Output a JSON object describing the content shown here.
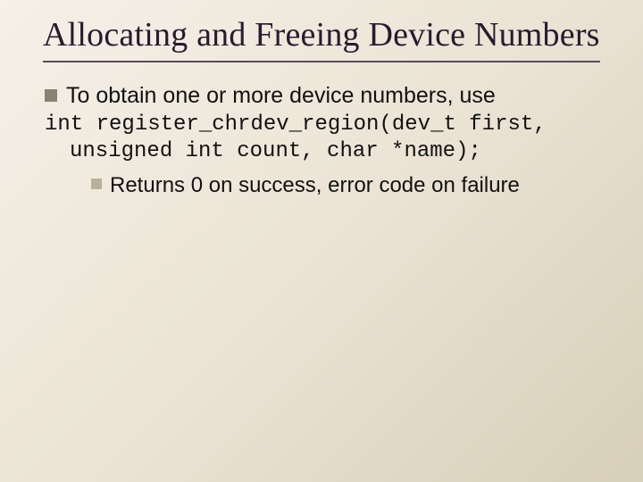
{
  "title": "Allocating and Freeing Device Numbers",
  "bullet1": "To obtain one or more device numbers, use",
  "code_line1": "int register_chrdev_region(dev_t first,",
  "code_line2": "unsigned int count, char *name);",
  "sub1": "Returns 0 on success, error code on failure"
}
